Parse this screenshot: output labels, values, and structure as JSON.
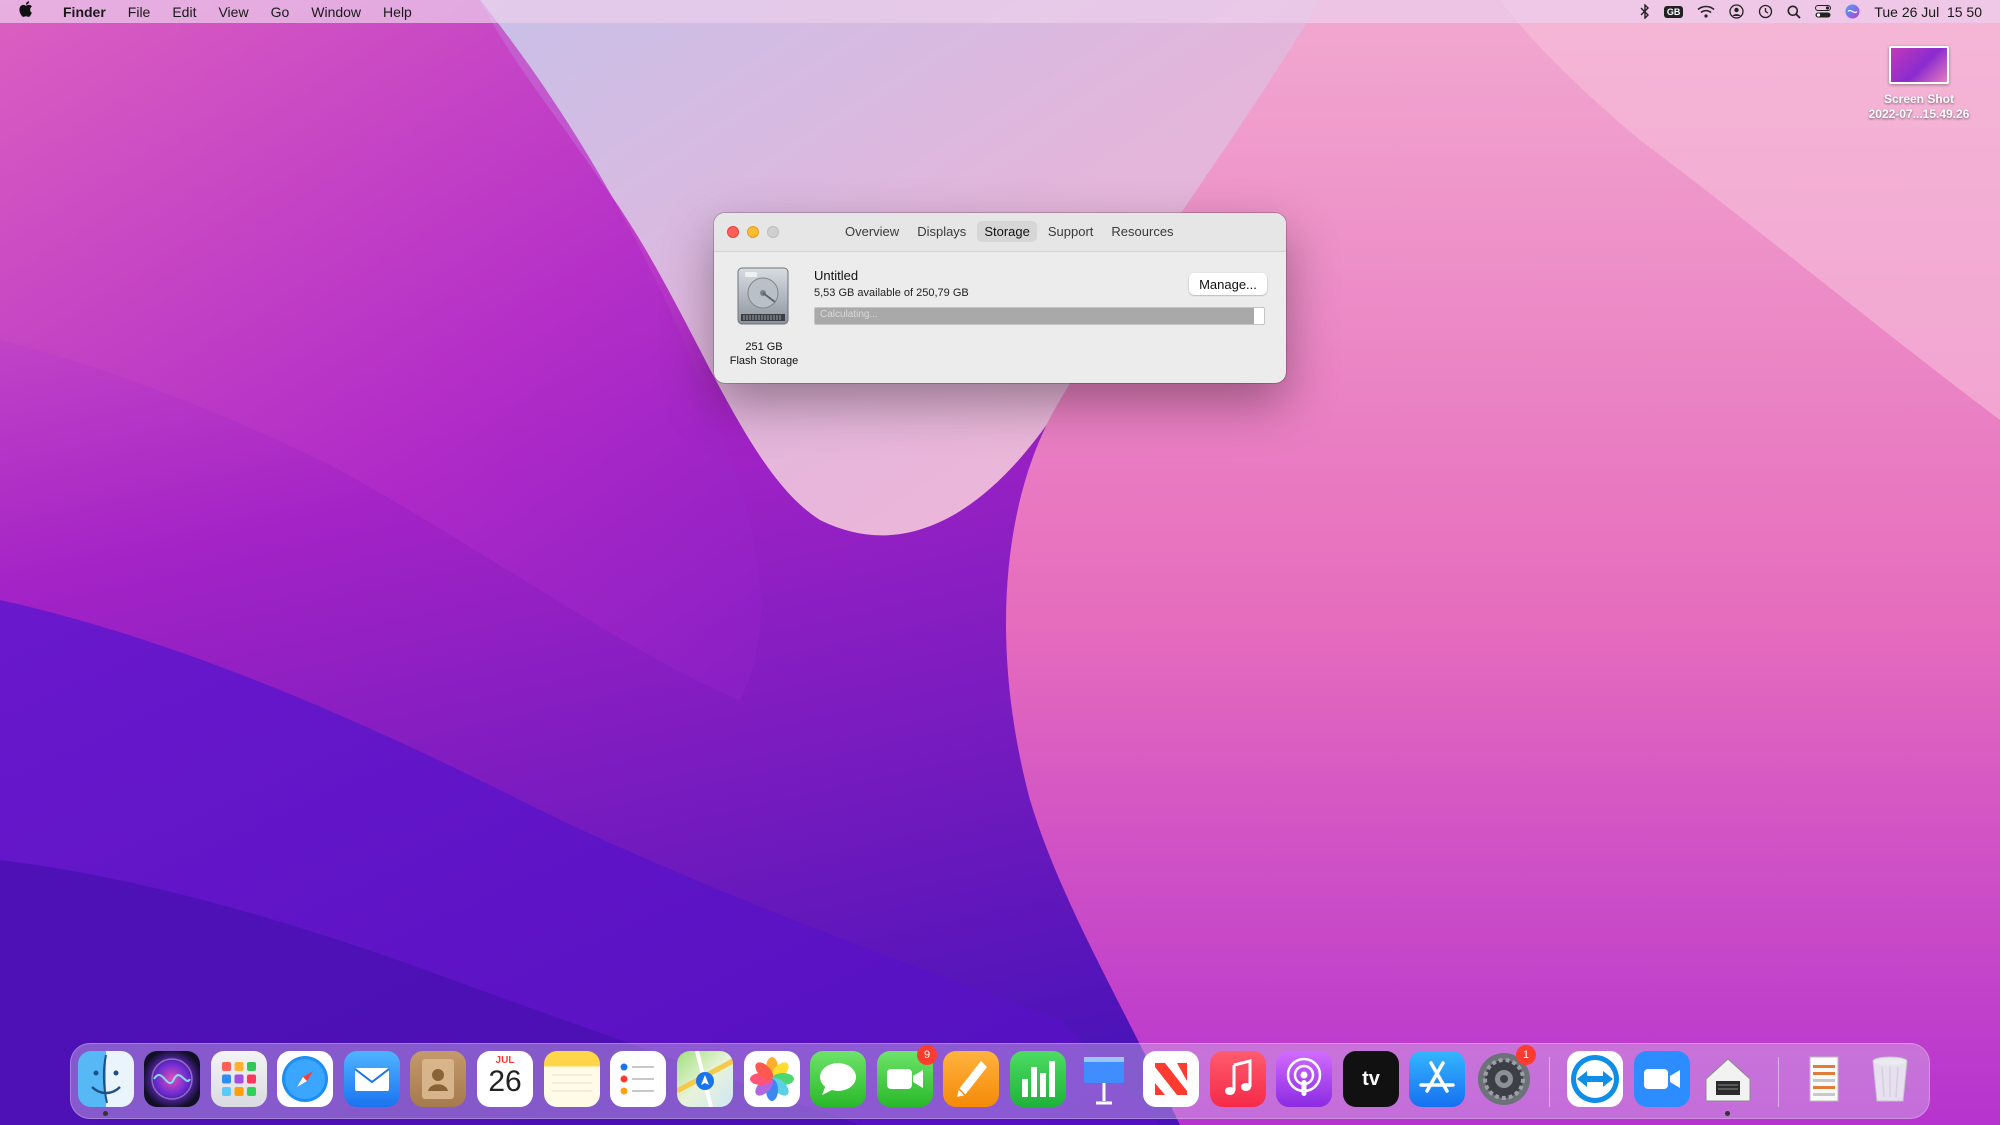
{
  "menubar": {
    "apple_icon": "apple-logo-icon",
    "app_name": "Finder",
    "menus": [
      "File",
      "Edit",
      "View",
      "Go",
      "Window",
      "Help"
    ],
    "status_icons": [
      "bluetooth-icon",
      "keyboard-input-icon",
      "wifi-icon",
      "user-icon",
      "time-machine-icon",
      "search-icon",
      "control-center-icon",
      "siri-icon"
    ],
    "keyboard_badge": "GB",
    "clock": "Tue 26 Jul  15 50"
  },
  "desktop": {
    "file_label_line1": "Screen Shot",
    "file_label_line2": "2022-07...15.49.26"
  },
  "window": {
    "tabs": [
      "Overview",
      "Displays",
      "Storage",
      "Support",
      "Resources"
    ],
    "active_tab": "Storage",
    "volume_name": "Untitled",
    "available_text": "5,53 GB available of 250,79 GB",
    "bar_text": "Calculating...",
    "bar_used_fraction": 0.978,
    "manage_label": "Manage...",
    "disk_size": "251 GB",
    "disk_type": "Flash Storage"
  },
  "dock": {
    "apps": [
      {
        "name": "finder",
        "icon": "finder-icon",
        "running": true
      },
      {
        "name": "siri",
        "icon": "siri-icon"
      },
      {
        "name": "launchpad",
        "icon": "launchpad-icon"
      },
      {
        "name": "safari",
        "icon": "safari-icon"
      },
      {
        "name": "mail",
        "icon": "mail-icon"
      },
      {
        "name": "contacts",
        "icon": "contacts-icon"
      },
      {
        "name": "calendar",
        "icon": "calendar-icon",
        "month": "JUL",
        "day": "26"
      },
      {
        "name": "notes",
        "icon": "notes-icon"
      },
      {
        "name": "reminders",
        "icon": "reminders-icon"
      },
      {
        "name": "maps",
        "icon": "maps-icon"
      },
      {
        "name": "photos",
        "icon": "photos-icon"
      },
      {
        "name": "messages",
        "icon": "messages-icon"
      },
      {
        "name": "facetime",
        "icon": "facetime-icon",
        "badge": "9"
      },
      {
        "name": "pages",
        "icon": "pages-icon"
      },
      {
        "name": "numbers",
        "icon": "numbers-icon"
      },
      {
        "name": "keynote",
        "icon": "keynote-icon"
      },
      {
        "name": "news",
        "icon": "news-icon"
      },
      {
        "name": "music",
        "icon": "music-icon"
      },
      {
        "name": "podcasts",
        "icon": "podcasts-icon"
      },
      {
        "name": "apple-tv",
        "icon": "apple-tv-icon",
        "label": "tv"
      },
      {
        "name": "app-store",
        "icon": "app-store-icon"
      },
      {
        "name": "system-preferences",
        "icon": "system-preferences-icon",
        "badge": "1"
      },
      {
        "name": "teamviewer",
        "icon": "teamviewer-icon"
      },
      {
        "name": "zoom",
        "icon": "zoom-icon"
      },
      {
        "name": "system-information",
        "icon": "system-information-icon",
        "running": true
      },
      {
        "name": "downloads-stack",
        "icon": "downloads-stack-icon"
      },
      {
        "name": "trash",
        "icon": "trash-icon"
      }
    ]
  },
  "colors": {
    "close": "#ff5f57",
    "minimize": "#febc2e",
    "badge": "#ff3b30",
    "wallpaper_top": "#e39ad0",
    "wallpaper_bottom": "#5b15c9"
  }
}
